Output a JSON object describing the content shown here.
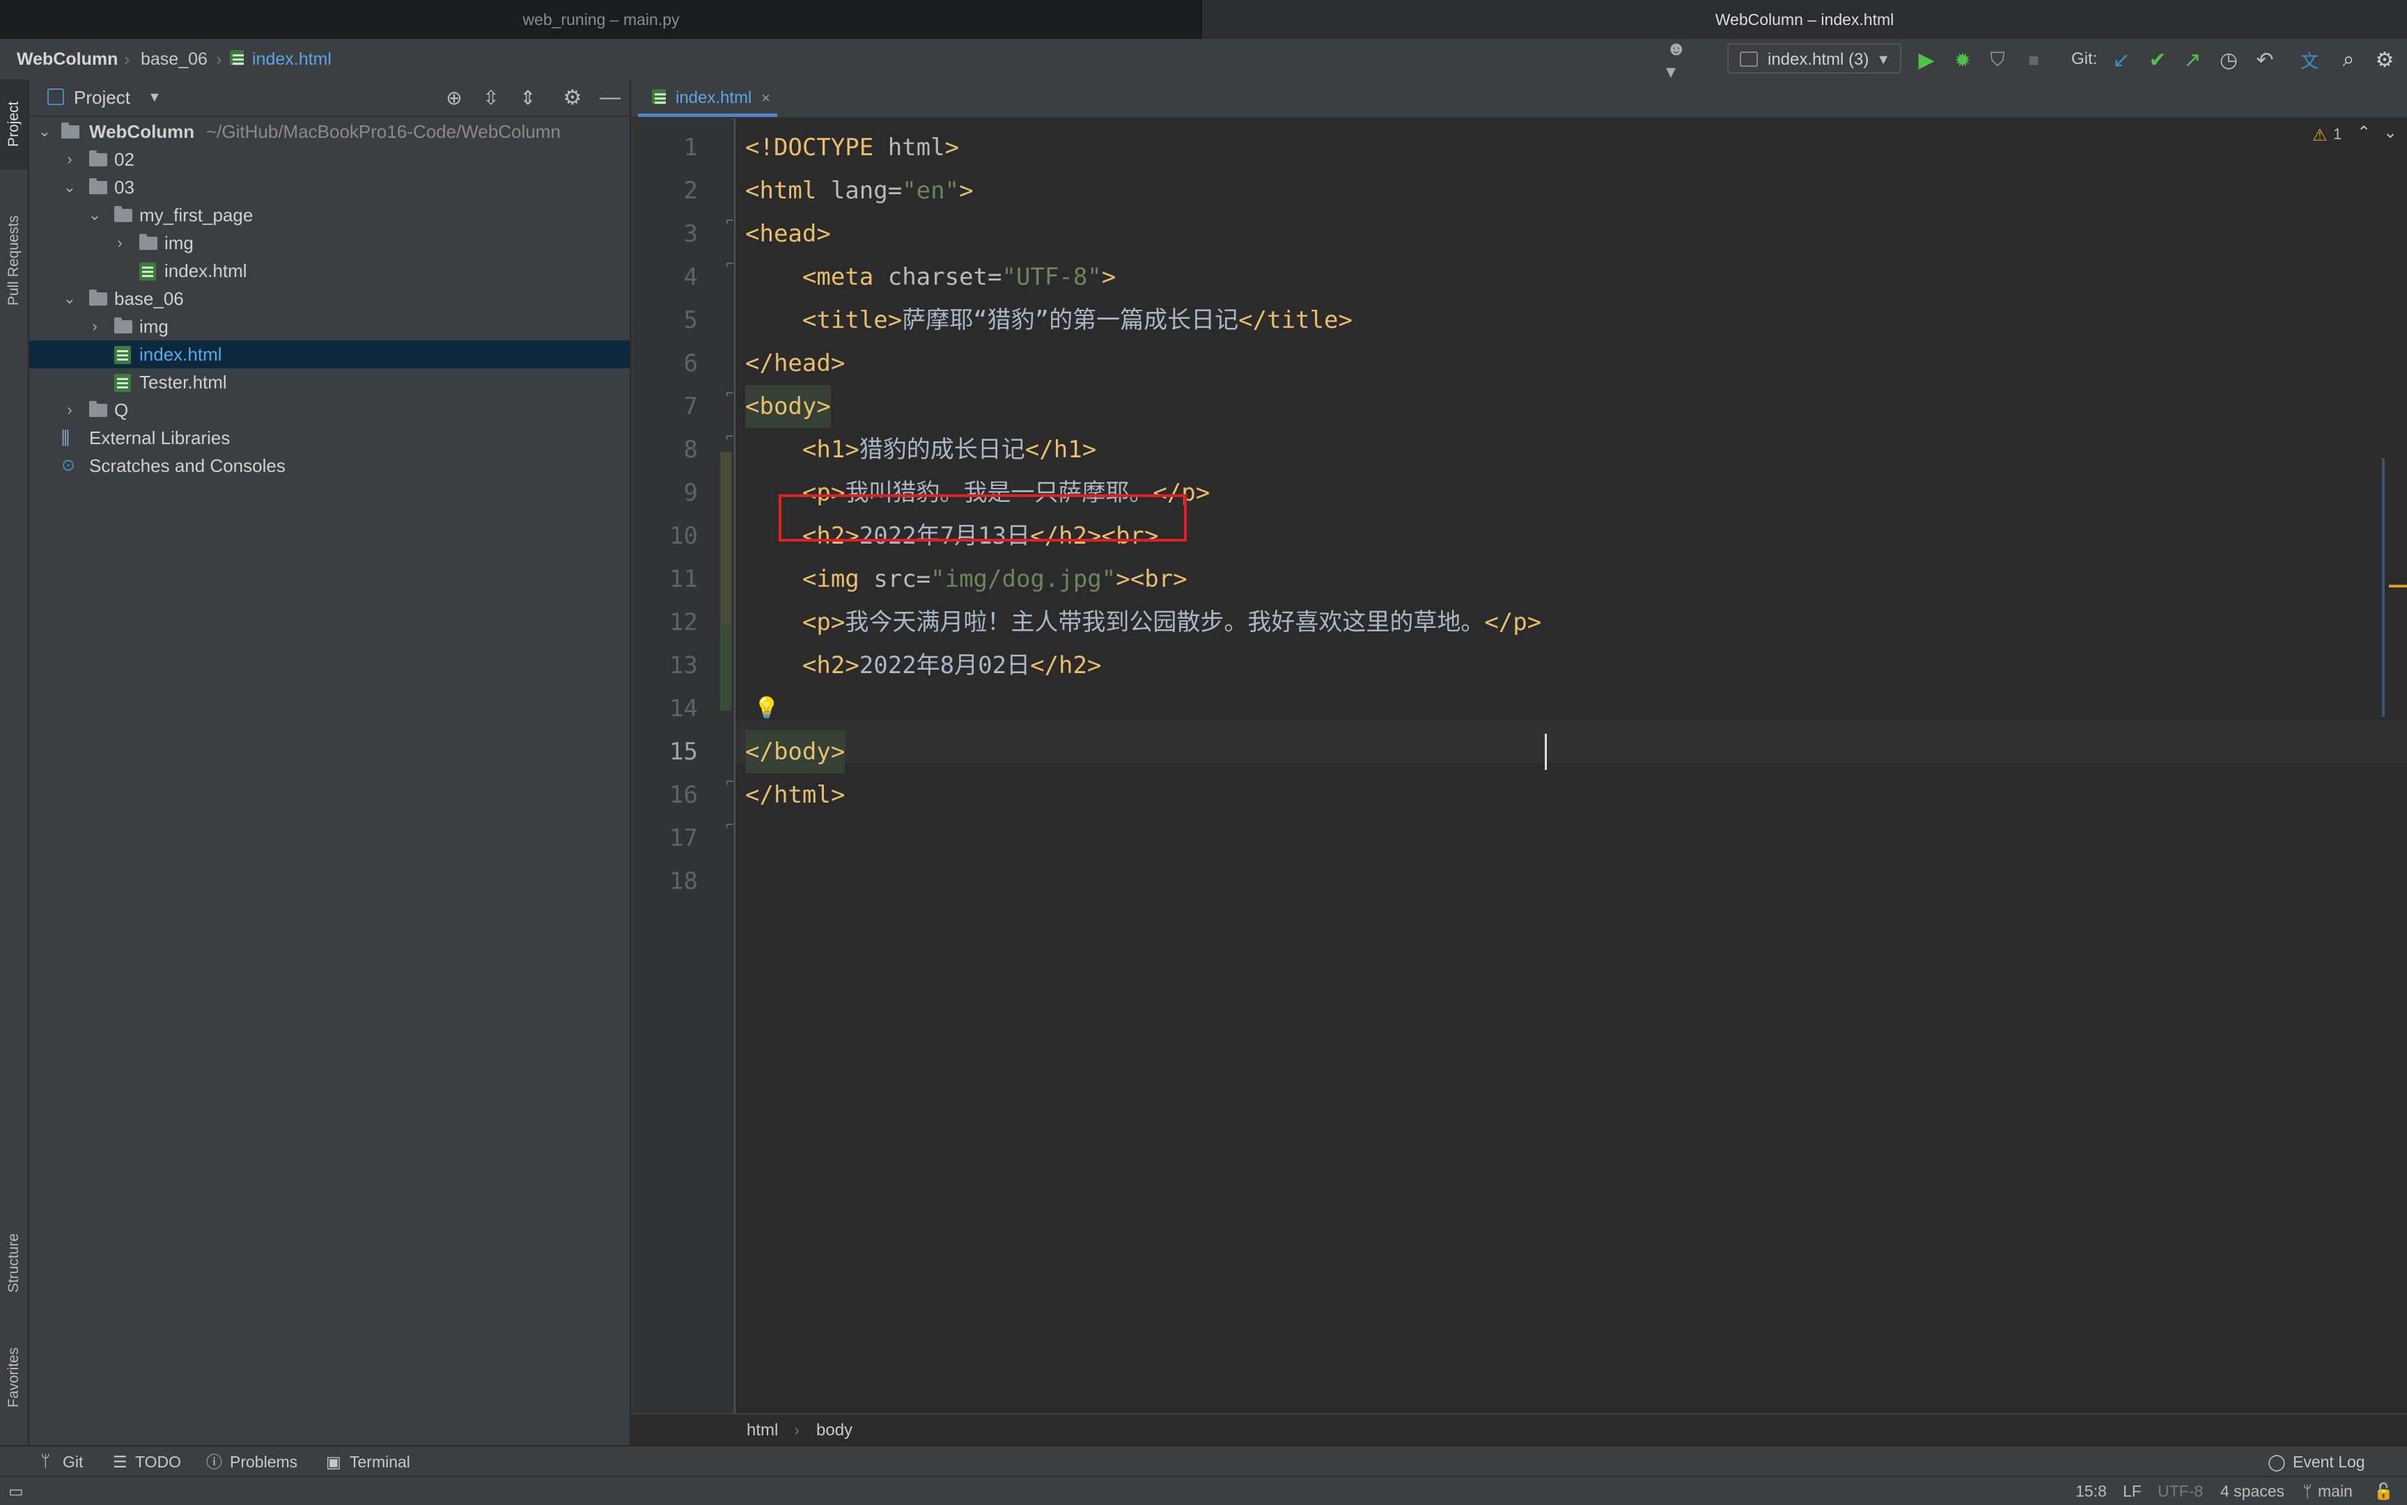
{
  "window_tabs": [
    "web_runing – main.py",
    "WebColumn – index.html"
  ],
  "breadcrumbs": [
    "WebColumn",
    "base_06",
    "index.html"
  ],
  "toolbar": {
    "run_config": "index.html (3)",
    "git_label": "Git:"
  },
  "left_strip": [
    "Project",
    "Pull Requests",
    "Structure",
    "Favorites"
  ],
  "project_panel": {
    "title": "Project",
    "root_name": "WebColumn",
    "root_path": "~/GitHub/MacBookPro16-Code/WebColumn",
    "items": [
      {
        "label": "02",
        "kind": "folder",
        "expanded": false
      },
      {
        "label": "03",
        "kind": "folder",
        "expanded": true
      },
      {
        "label": "my_first_page",
        "kind": "folder",
        "expanded": true
      },
      {
        "label": "img",
        "kind": "folder",
        "expanded": false
      },
      {
        "label": "index.html",
        "kind": "html"
      },
      {
        "label": "base_06",
        "kind": "folder",
        "expanded": true
      },
      {
        "label": "img",
        "kind": "folder",
        "expanded": false
      },
      {
        "label": "index.html",
        "kind": "html",
        "selected": true
      },
      {
        "label": "Tester.html",
        "kind": "html"
      },
      {
        "label": "Q",
        "kind": "folder",
        "expanded": false
      },
      {
        "label": "External Libraries",
        "kind": "libraries"
      },
      {
        "label": "Scratches and Consoles",
        "kind": "scratches"
      }
    ]
  },
  "editor": {
    "tab_label": "index.html",
    "warning_count": "1",
    "line_numbers": [
      "1",
      "2",
      "3",
      "4",
      "5",
      "6",
      "7",
      "8",
      "9",
      "10",
      "11",
      "12",
      "13",
      "14",
      "15",
      "16",
      "17",
      "18"
    ],
    "current_line": "15",
    "code_lines": [
      "<!DOCTYPE html>",
      "<html lang=\"en\">",
      "<head>",
      "    <meta charset=\"UTF-8\">",
      "    <title>萨摩耶“猎豹”的第一篇成长日记</title>",
      "</head>",
      "<body>",
      "    <h1>猎豹的成长日记</h1>",
      "    <p>我叫猎豹。我是一只萨摩耶。</p>",
      "    <h2>2022年7月13日</h2><br>",
      "    <img src=\"img/dog.jpg\"><br>",
      "    <p>我今天满月啦！主人带我到公园散步。我好喜欢这里的草地。</p>",
      "    <h2>2022年8月02日</h2>",
      "",
      "</body>",
      "</html>",
      "",
      ""
    ],
    "breadcrumb": [
      "html",
      "body"
    ]
  },
  "bottom_tools": [
    "Git",
    "TODO",
    "Problems",
    "Terminal",
    "Event Log"
  ],
  "status": {
    "position": "15:8",
    "line_ending": "LF",
    "encoding": "UTF-8",
    "indent": "4 spaces",
    "branch": "main"
  },
  "colors": {
    "tag": "#e8bf6a",
    "attr_value": "#6a8759",
    "highlight_box": "#e02020",
    "run_green": "#4fc24a"
  }
}
